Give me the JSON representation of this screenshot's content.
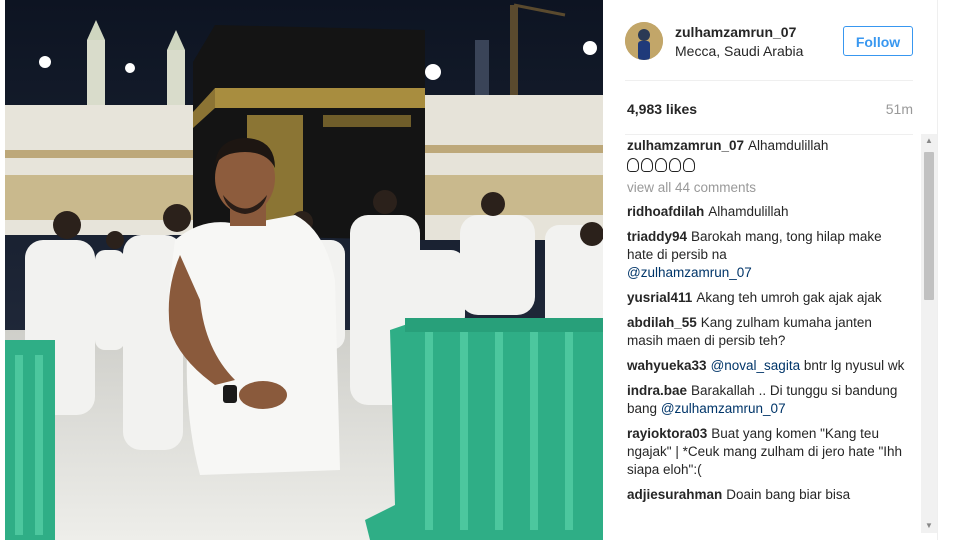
{
  "post": {
    "username": "zulhamzamrun_07",
    "location": "Mecca, Saudi Arabia",
    "follow_label": "Follow",
    "likes": "4,983 likes",
    "time": "51m",
    "caption": {
      "user": "zulhamzamrun_07",
      "text": "Alhamdulillah"
    },
    "view_all": "view all 44 comments"
  },
  "comments": [
    {
      "user": "ridhoafdilah",
      "text": "Alhamdulillah",
      "mention": ""
    },
    {
      "user": "triaddy94",
      "text": "Barokah mang, tong hilap make hate di persib na",
      "mention": "@zulhamzamrun_07"
    },
    {
      "user": "yusrial411",
      "text": "Akang teh umroh gak ajak ajak",
      "mention": ""
    },
    {
      "user": "abdilah_55",
      "text": "Kang zulham kumaha janten masih maen di persib teh?",
      "mention": ""
    },
    {
      "user": "wahyueka33",
      "text": "bntr lg nyusul wk",
      "mention": "@noval_sagita"
    },
    {
      "user": "indra.bae",
      "text": "Barakallah .. Di tunggu si bandung bang",
      "mention": "@zulhamzamrun_07"
    },
    {
      "user": "rayioktora03",
      "text": "Buat yang komen \"Kang teu ngajak\" | *Ceuk mang zulham di jero hate \"Ihh siapa eloh\":(",
      "mention": ""
    },
    {
      "user": "adjiesurahman",
      "text": "Doain bang biar bisa",
      "mention": ""
    }
  ],
  "icons": {
    "scroll_up": "triangle-up-icon",
    "scroll_down": "triangle-down-icon"
  },
  "colors": {
    "follow_blue": "#3897f0",
    "mention_blue": "#003569",
    "muted": "#999999"
  }
}
